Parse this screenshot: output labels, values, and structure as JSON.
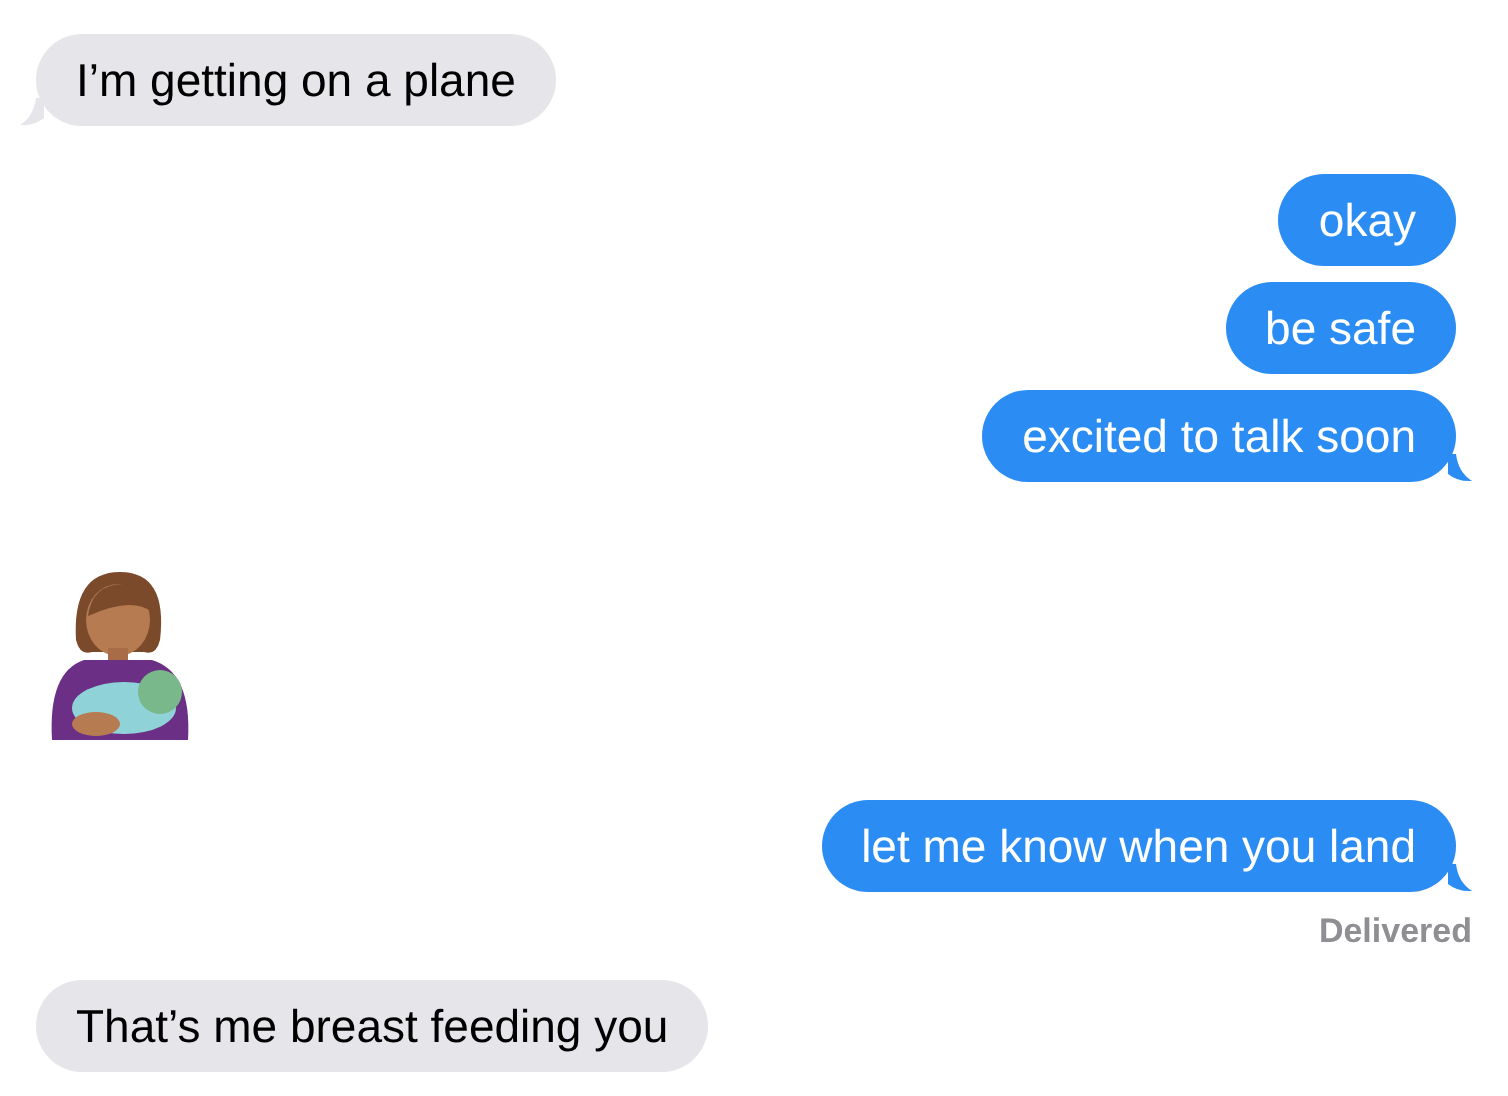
{
  "messages": [
    {
      "kind": "text",
      "outgoing": false,
      "text": "I’m getting on a plane",
      "tail": true
    },
    {
      "kind": "text",
      "outgoing": true,
      "text": "okay",
      "tail": false
    },
    {
      "kind": "text",
      "outgoing": true,
      "text": "be safe",
      "tail": false
    },
    {
      "kind": "text",
      "outgoing": true,
      "text": "excited to talk soon",
      "tail": true
    },
    {
      "kind": "emoji",
      "outgoing": false
    },
    {
      "kind": "text",
      "outgoing": true,
      "text": "let me know when you land",
      "tail": true,
      "status": "Delivered"
    },
    {
      "kind": "text",
      "outgoing": false,
      "text": "That’s me breast feeding you",
      "tail": false
    }
  ]
}
